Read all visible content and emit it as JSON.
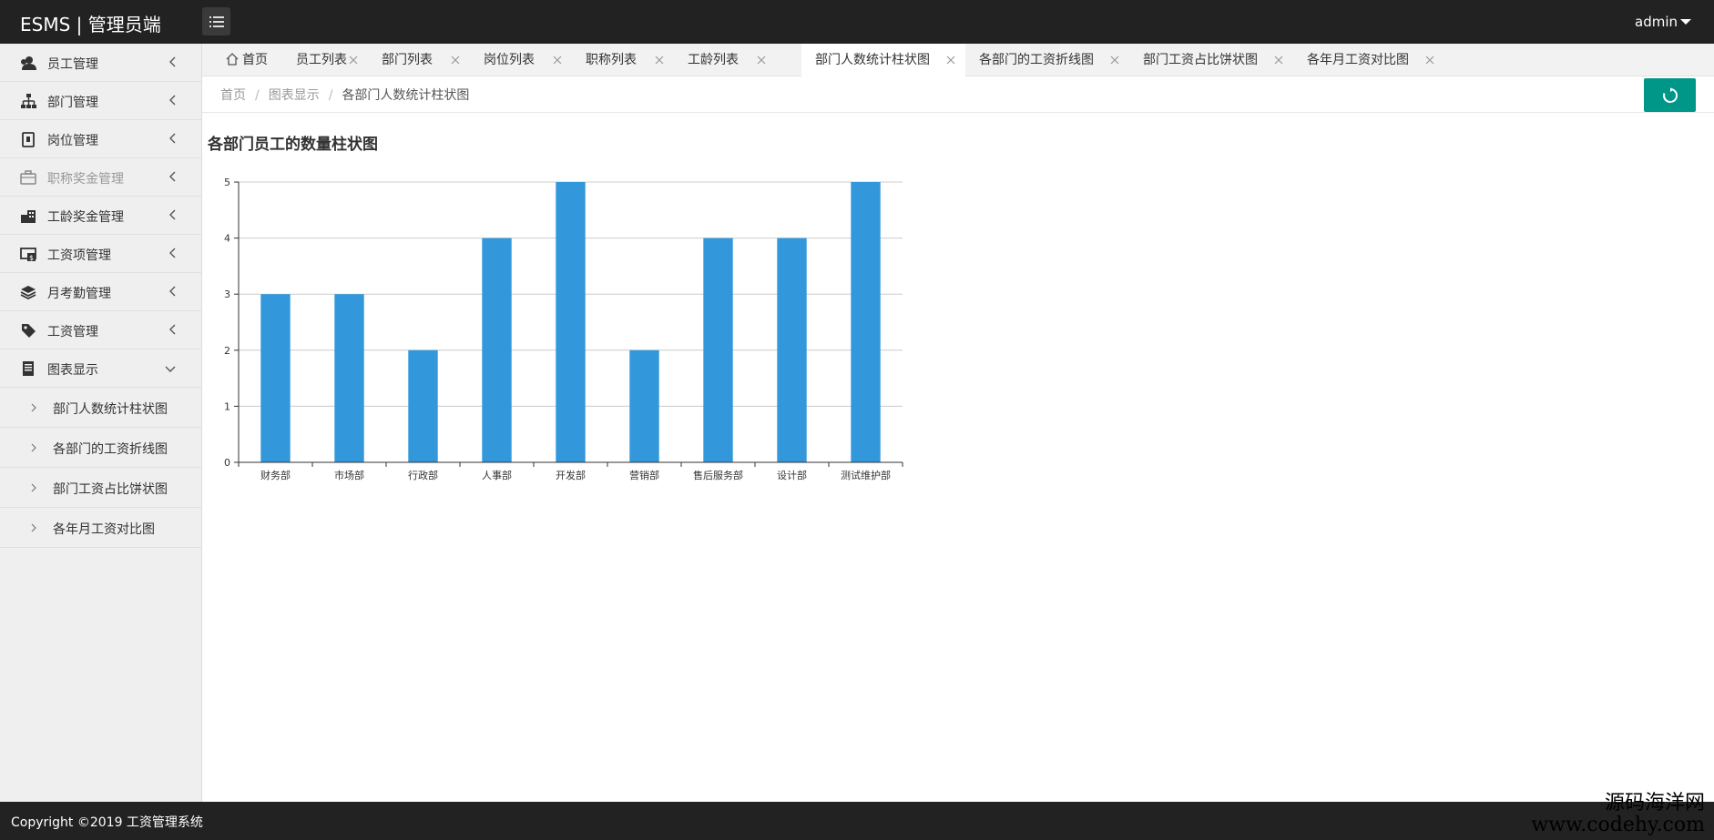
{
  "header": {
    "brand": "ESMS | 管理员端",
    "user": "admin"
  },
  "sidebar": {
    "items": [
      {
        "label": "员工管理",
        "icon": "users-icon",
        "muted": false
      },
      {
        "label": "部门管理",
        "icon": "sitemap-icon",
        "muted": false
      },
      {
        "label": "岗位管理",
        "icon": "badge-icon",
        "muted": false
      },
      {
        "label": "职称奖金管理",
        "icon": "briefcase-icon",
        "muted": true
      },
      {
        "label": "工龄奖金管理",
        "icon": "building-icon",
        "muted": false
      },
      {
        "label": "工资项管理",
        "icon": "money-icon",
        "muted": false
      },
      {
        "label": "月考勤管理",
        "icon": "layers-icon",
        "muted": false
      },
      {
        "label": "工资管理",
        "icon": "tag-icon",
        "muted": false
      },
      {
        "label": "图表显示",
        "icon": "chart-book-icon",
        "muted": false
      }
    ],
    "sub_items": [
      {
        "label": "部门人数统计柱状图"
      },
      {
        "label": "各部门的工资折线图"
      },
      {
        "label": "部门工资占比饼状图"
      },
      {
        "label": "各年月工资对比图"
      }
    ]
  },
  "tabs": [
    {
      "label": "首页",
      "closable": false,
      "active": false
    },
    {
      "label": "员工列表",
      "closable": true,
      "active": false
    },
    {
      "label": "部门列表",
      "closable": true,
      "active": false
    },
    {
      "label": "岗位列表",
      "closable": true,
      "active": false
    },
    {
      "label": "职称列表",
      "closable": true,
      "active": false
    },
    {
      "label": "工龄列表",
      "closable": true,
      "active": false
    },
    {
      "label": "部门人数统计柱状图",
      "closable": true,
      "active": true
    },
    {
      "label": "各部门的工资折线图",
      "closable": true,
      "active": false
    },
    {
      "label": "部门工资占比饼状图",
      "closable": true,
      "active": false
    },
    {
      "label": "各年月工资对比图",
      "closable": true,
      "active": false
    }
  ],
  "breadcrumb": {
    "items": [
      "首页",
      "图表显示",
      "各部门人数统计柱状图"
    ],
    "separator": "/"
  },
  "chart_data": {
    "type": "bar",
    "title": "各部门员工的数量柱状图",
    "categories": [
      "财务部",
      "市场部",
      "行政部",
      "人事部",
      "开发部",
      "营销部",
      "售后服务部",
      "设计部",
      "测试维护部"
    ],
    "values": [
      3,
      3,
      2,
      4,
      5,
      2,
      4,
      4,
      5
    ],
    "yticks": [
      "0",
      "1",
      "2",
      "3",
      "4",
      "5"
    ],
    "ylim": [
      0,
      5
    ],
    "grid": true,
    "color": "#3398db"
  },
  "footer": {
    "copyright": "Copyright ©2019 工资管理系统"
  },
  "watermark": {
    "line1": "源码海洋网",
    "line2": "www.codehy.com"
  },
  "colors": {
    "topbar": "#222222",
    "accent": "#009688",
    "bar": "#3398db"
  }
}
